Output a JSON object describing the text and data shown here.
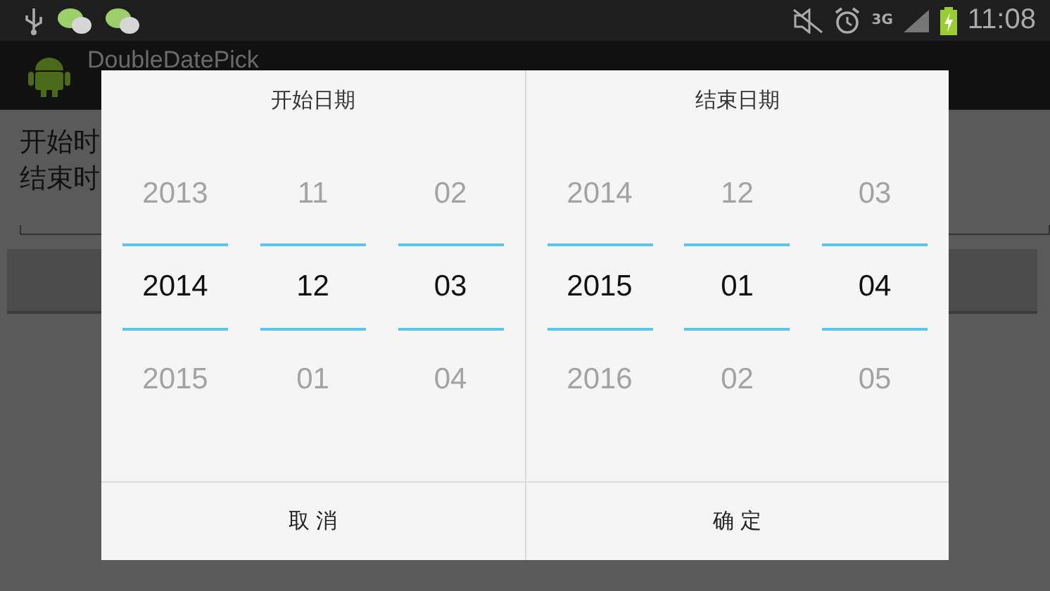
{
  "status_bar": {
    "network": "3G",
    "time": "11:08"
  },
  "app": {
    "title": "DoubleDatePick",
    "lines": [
      "开始时",
      "结束时"
    ]
  },
  "dialog": {
    "panels": [
      {
        "title": "开始日期",
        "wheels": [
          {
            "above": "2013",
            "value": "2014",
            "below": "2015"
          },
          {
            "above": "11",
            "value": "12",
            "below": "01"
          },
          {
            "above": "02",
            "value": "03",
            "below": "04"
          }
        ]
      },
      {
        "title": "结束日期",
        "wheels": [
          {
            "above": "2014",
            "value": "2015",
            "below": "2016"
          },
          {
            "above": "12",
            "value": "01",
            "below": "02"
          },
          {
            "above": "03",
            "value": "04",
            "below": "05"
          }
        ]
      }
    ],
    "buttons": [
      "取 消",
      "确 定"
    ]
  }
}
